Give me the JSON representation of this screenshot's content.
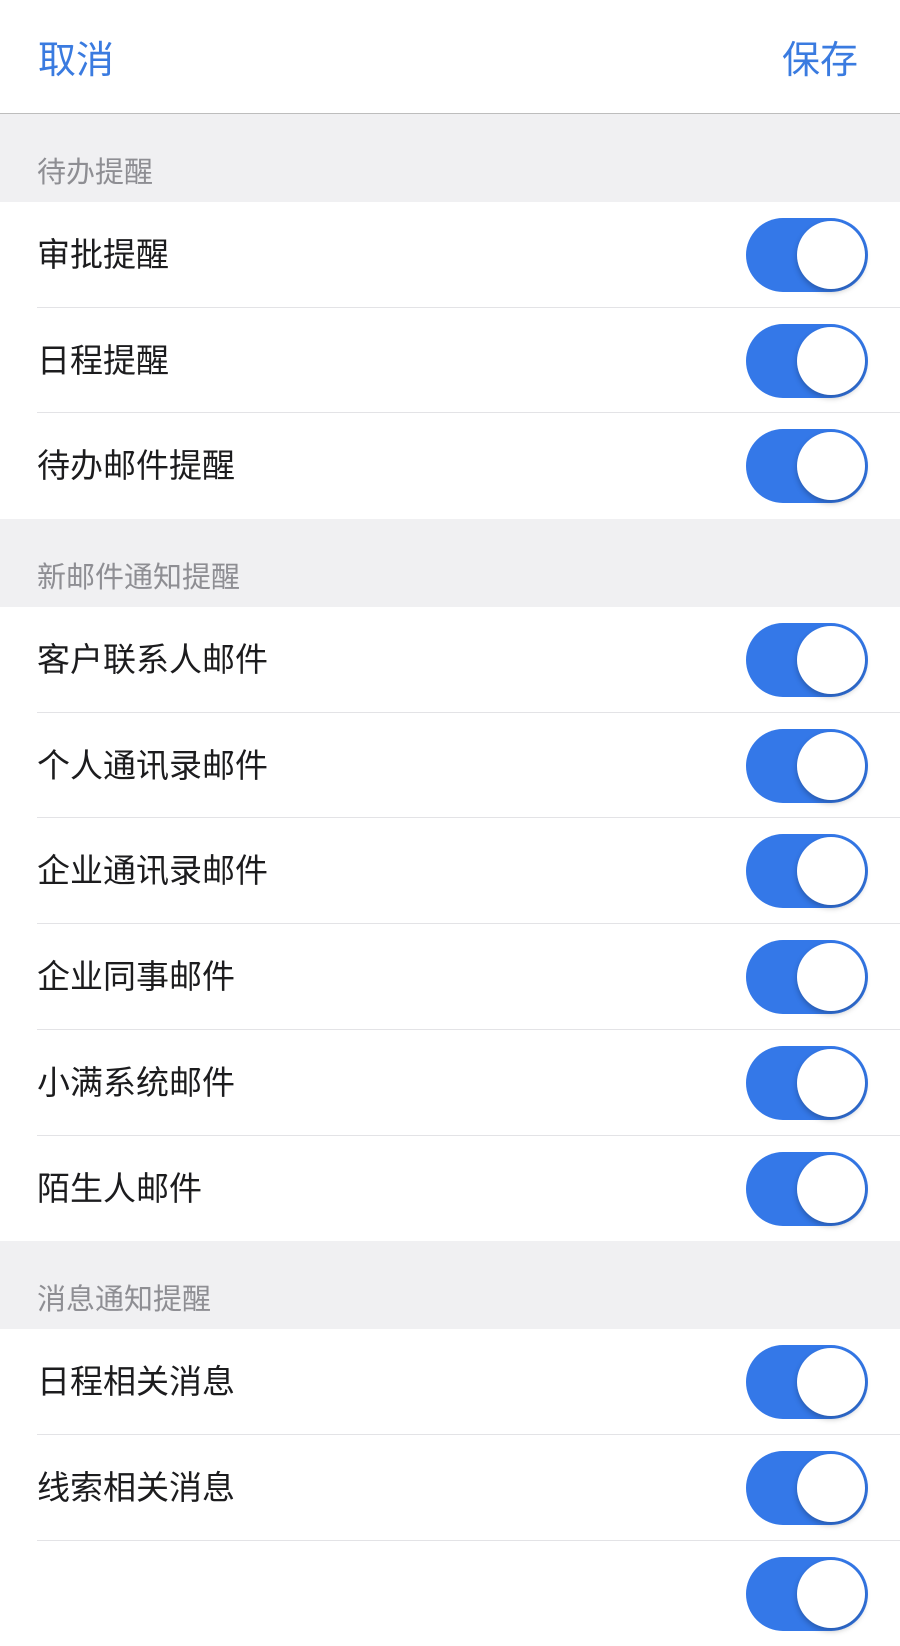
{
  "navbar": {
    "cancel_label": "取消",
    "save_label": "保存"
  },
  "colors": {
    "accent": "#3a7be0",
    "toggle_on": "#3478e8",
    "section_bg": "#f0f0f2"
  },
  "sections": [
    {
      "title": "待办提醒",
      "items": [
        {
          "label": "审批提醒",
          "enabled": true
        },
        {
          "label": "日程提醒",
          "enabled": true
        },
        {
          "label": "待办邮件提醒",
          "enabled": true
        }
      ]
    },
    {
      "title": "新邮件通知提醒",
      "items": [
        {
          "label": "客户联系人邮件",
          "enabled": true
        },
        {
          "label": "个人通讯录邮件",
          "enabled": true
        },
        {
          "label": "企业通讯录邮件",
          "enabled": true
        },
        {
          "label": "企业同事邮件",
          "enabled": true
        },
        {
          "label": "小满系统邮件",
          "enabled": true
        },
        {
          "label": "陌生人邮件",
          "enabled": true
        }
      ]
    },
    {
      "title": "消息通知提醒",
      "items": [
        {
          "label": "日程相关消息",
          "enabled": true
        },
        {
          "label": "线索相关消息",
          "enabled": true
        },
        {
          "label": "",
          "enabled": true
        }
      ]
    }
  ]
}
